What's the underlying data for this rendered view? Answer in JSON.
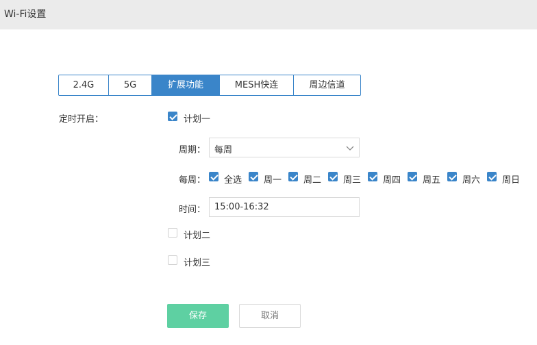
{
  "header": {
    "title": "Wi-Fi设置"
  },
  "tabs": [
    {
      "label": "2.4G",
      "active": false
    },
    {
      "label": "5G",
      "active": false
    },
    {
      "label": "扩展功能",
      "active": true
    },
    {
      "label": "MESH快连",
      "active": false
    },
    {
      "label": "周边信道",
      "active": false
    }
  ],
  "schedule": {
    "label": "定时开启：",
    "plan1": {
      "label": "计划一",
      "checked": true,
      "period_label": "周期：",
      "period_value": "每周",
      "weekly_label": "每周：",
      "days": [
        {
          "label": "全选",
          "checked": true
        },
        {
          "label": "周一",
          "checked": true
        },
        {
          "label": "周二",
          "checked": true
        },
        {
          "label": "周三",
          "checked": true
        },
        {
          "label": "周四",
          "checked": true
        },
        {
          "label": "周五",
          "checked": true
        },
        {
          "label": "周六",
          "checked": true
        },
        {
          "label": "周日",
          "checked": true
        }
      ],
      "time_label": "时间：",
      "time_value": "15:00-16:32"
    },
    "plan2": {
      "label": "计划二",
      "checked": false
    },
    "plan3": {
      "label": "计划三",
      "checked": false
    }
  },
  "buttons": {
    "save": "保存",
    "cancel": "取消"
  },
  "colors": {
    "accent": "#3a85c9",
    "save": "#5ed0a2",
    "header_bg": "#ebebeb"
  }
}
